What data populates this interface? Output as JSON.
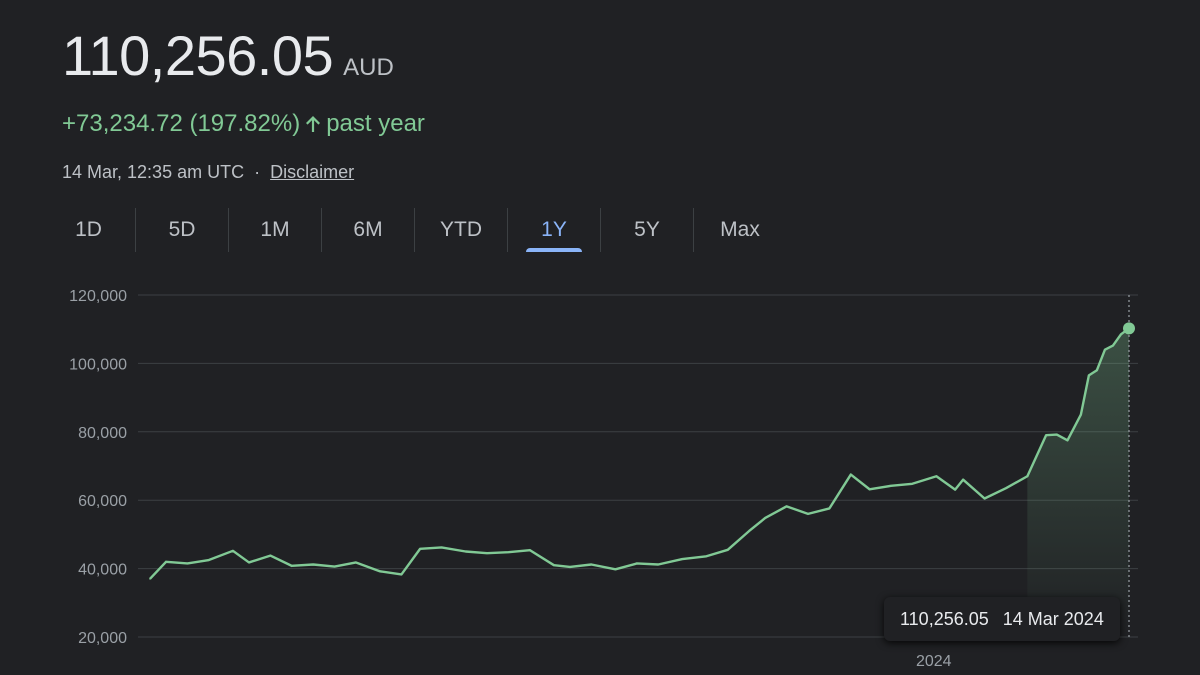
{
  "quote": {
    "price": "110,256.05",
    "currency": "AUD",
    "change": "+73,234.72 (197.82%)",
    "change_arrow_icon": "arrow-up-icon",
    "change_period": "past year",
    "timestamp": "14 Mar, 12:35 am UTC",
    "separator": "·",
    "disclaimer_label": "Disclaimer"
  },
  "colors": {
    "background": "#202124",
    "positive": "#81c995",
    "accent_tab": "#8ab4f8",
    "gridline": "#3c4043"
  },
  "tabs": [
    {
      "label": "1D",
      "active": false
    },
    {
      "label": "5D",
      "active": false
    },
    {
      "label": "1M",
      "active": false
    },
    {
      "label": "6M",
      "active": false
    },
    {
      "label": "YTD",
      "active": false
    },
    {
      "label": "1Y",
      "active": true
    },
    {
      "label": "5Y",
      "active": false
    },
    {
      "label": "Max",
      "active": false
    }
  ],
  "tooltip": {
    "value": "110,256.05",
    "date": "14 Mar 2024"
  },
  "chart_data": {
    "type": "area",
    "title": "",
    "xlabel": "",
    "ylabel": "",
    "ylim": [
      20000,
      120000
    ],
    "yticks": [
      20000,
      40000,
      60000,
      80000,
      100000,
      120000
    ],
    "ytick_labels": [
      "20,000",
      "40,000",
      "60,000",
      "80,000",
      "100,000",
      "120,000"
    ],
    "xlim": [
      "2023-03-14",
      "2024-03-14"
    ],
    "xtick_labels": [
      {
        "date": "2024-01-01",
        "label": "2024"
      }
    ],
    "grid": true,
    "series": [
      {
        "color": "#81c995",
        "x": [
          "2023-03-14",
          "2023-03-20",
          "2023-03-28",
          "2023-04-05",
          "2023-04-14",
          "2023-04-20",
          "2023-04-28",
          "2023-05-06",
          "2023-05-14",
          "2023-05-22",
          "2023-05-30",
          "2023-06-08",
          "2023-06-16",
          "2023-06-23",
          "2023-07-01",
          "2023-07-10",
          "2023-07-18",
          "2023-07-26",
          "2023-08-03",
          "2023-08-12",
          "2023-08-18",
          "2023-08-26",
          "2023-09-04",
          "2023-09-12",
          "2023-09-20",
          "2023-09-29",
          "2023-10-08",
          "2023-10-16",
          "2023-10-24",
          "2023-10-30",
          "2023-11-07",
          "2023-11-15",
          "2023-11-23",
          "2023-12-01",
          "2023-12-08",
          "2023-12-16",
          "2023-12-24",
          "2024-01-02",
          "2024-01-09",
          "2024-01-12",
          "2024-01-20",
          "2024-01-28",
          "2024-02-05",
          "2024-02-12",
          "2024-02-16",
          "2024-02-20",
          "2024-02-25",
          "2024-02-28",
          "2024-03-02",
          "2024-03-05",
          "2024-03-08",
          "2024-03-11",
          "2024-03-14"
        ],
        "y": [
          37000,
          42000,
          41500,
          42500,
          45200,
          41800,
          43800,
          40800,
          41200,
          40600,
          41800,
          39200,
          38300,
          45800,
          46200,
          45000,
          44500,
          44800,
          45400,
          41000,
          40500,
          41200,
          39800,
          41500,
          41200,
          42800,
          43600,
          45500,
          51000,
          54800,
          58200,
          56000,
          57600,
          67500,
          63200,
          64200,
          64800,
          67000,
          63100,
          66000,
          60500,
          63500,
          67000,
          79000,
          79200,
          77500,
          85000,
          96500,
          98000,
          104000,
          105200,
          108500,
          110256
        ]
      }
    ]
  }
}
